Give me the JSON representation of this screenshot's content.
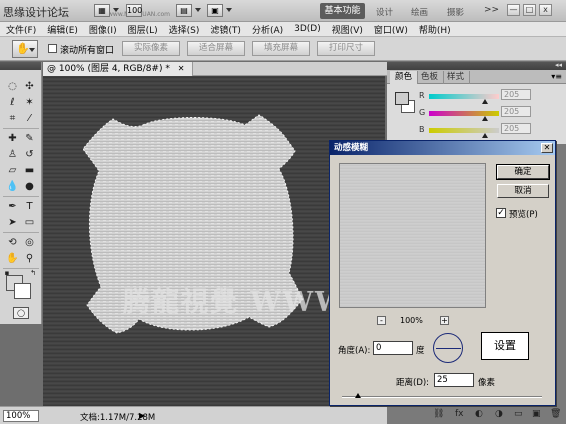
{
  "appbar": {
    "brand": "思缘设计论坛",
    "brand_sub": "www.MISSYUAN.com",
    "workspace_active": "基本功能",
    "workspaces": [
      "设计",
      "绘画",
      "摄影"
    ],
    "more": ">>",
    "minimize": "—",
    "maximize": "□",
    "close": "x"
  },
  "menus": [
    "文件(F)",
    "编辑(E)",
    "图像(I)",
    "图层(L)",
    "选择(S)",
    "滤镜(T)",
    "分析(A)",
    "3D(D)",
    "视图(V)",
    "窗口(W)",
    "帮助(H)"
  ],
  "options": {
    "scroll_all_label": "滚动所有窗口",
    "scroll_all_checked": false,
    "buttons": [
      "实际像素",
      "适合屏幕",
      "填充屏幕",
      "打印尺寸"
    ]
  },
  "document": {
    "tab_title": "@ 100% (图层 4, RGB/8#) *",
    "zoom": "100%",
    "info": "文档:1.17M/7.28M",
    "watermark": "腾龍視覺 WWW.TLVI.NET"
  },
  "panels": {
    "tabs": [
      "颜色",
      "色板",
      "样式"
    ],
    "active_tab": "颜色",
    "channels": [
      {
        "label": "R",
        "value": "205",
        "level": 0.8
      },
      {
        "label": "G",
        "value": "205",
        "level": 0.8
      },
      {
        "label": "B",
        "value": "205",
        "level": 0.8
      }
    ],
    "channel_colors": {
      "R": [
        "#00cccc",
        "#ffcccc"
      ],
      "G": [
        "#cc00cc",
        "#cccc00"
      ],
      "B": [
        "#cccc00",
        "#cccccc"
      ]
    }
  },
  "dialog": {
    "title": "动感模糊",
    "ok": "确定",
    "cancel": "取消",
    "preview_label": "预览(P)",
    "preview_checked": true,
    "zoom_minus": "-",
    "zoom_plus": "+",
    "zoom": "100%",
    "angle_label": "角度(A):",
    "angle_value": "0",
    "angle_unit": "度",
    "settings_label": "设置",
    "distance_label": "距离(D):",
    "distance_value": "25",
    "distance_unit": "像素"
  },
  "colors": {
    "accent_title": "#0a246a",
    "canvas_dark": "#3a3a3a",
    "fg_swatch": "#d9d9d9"
  }
}
